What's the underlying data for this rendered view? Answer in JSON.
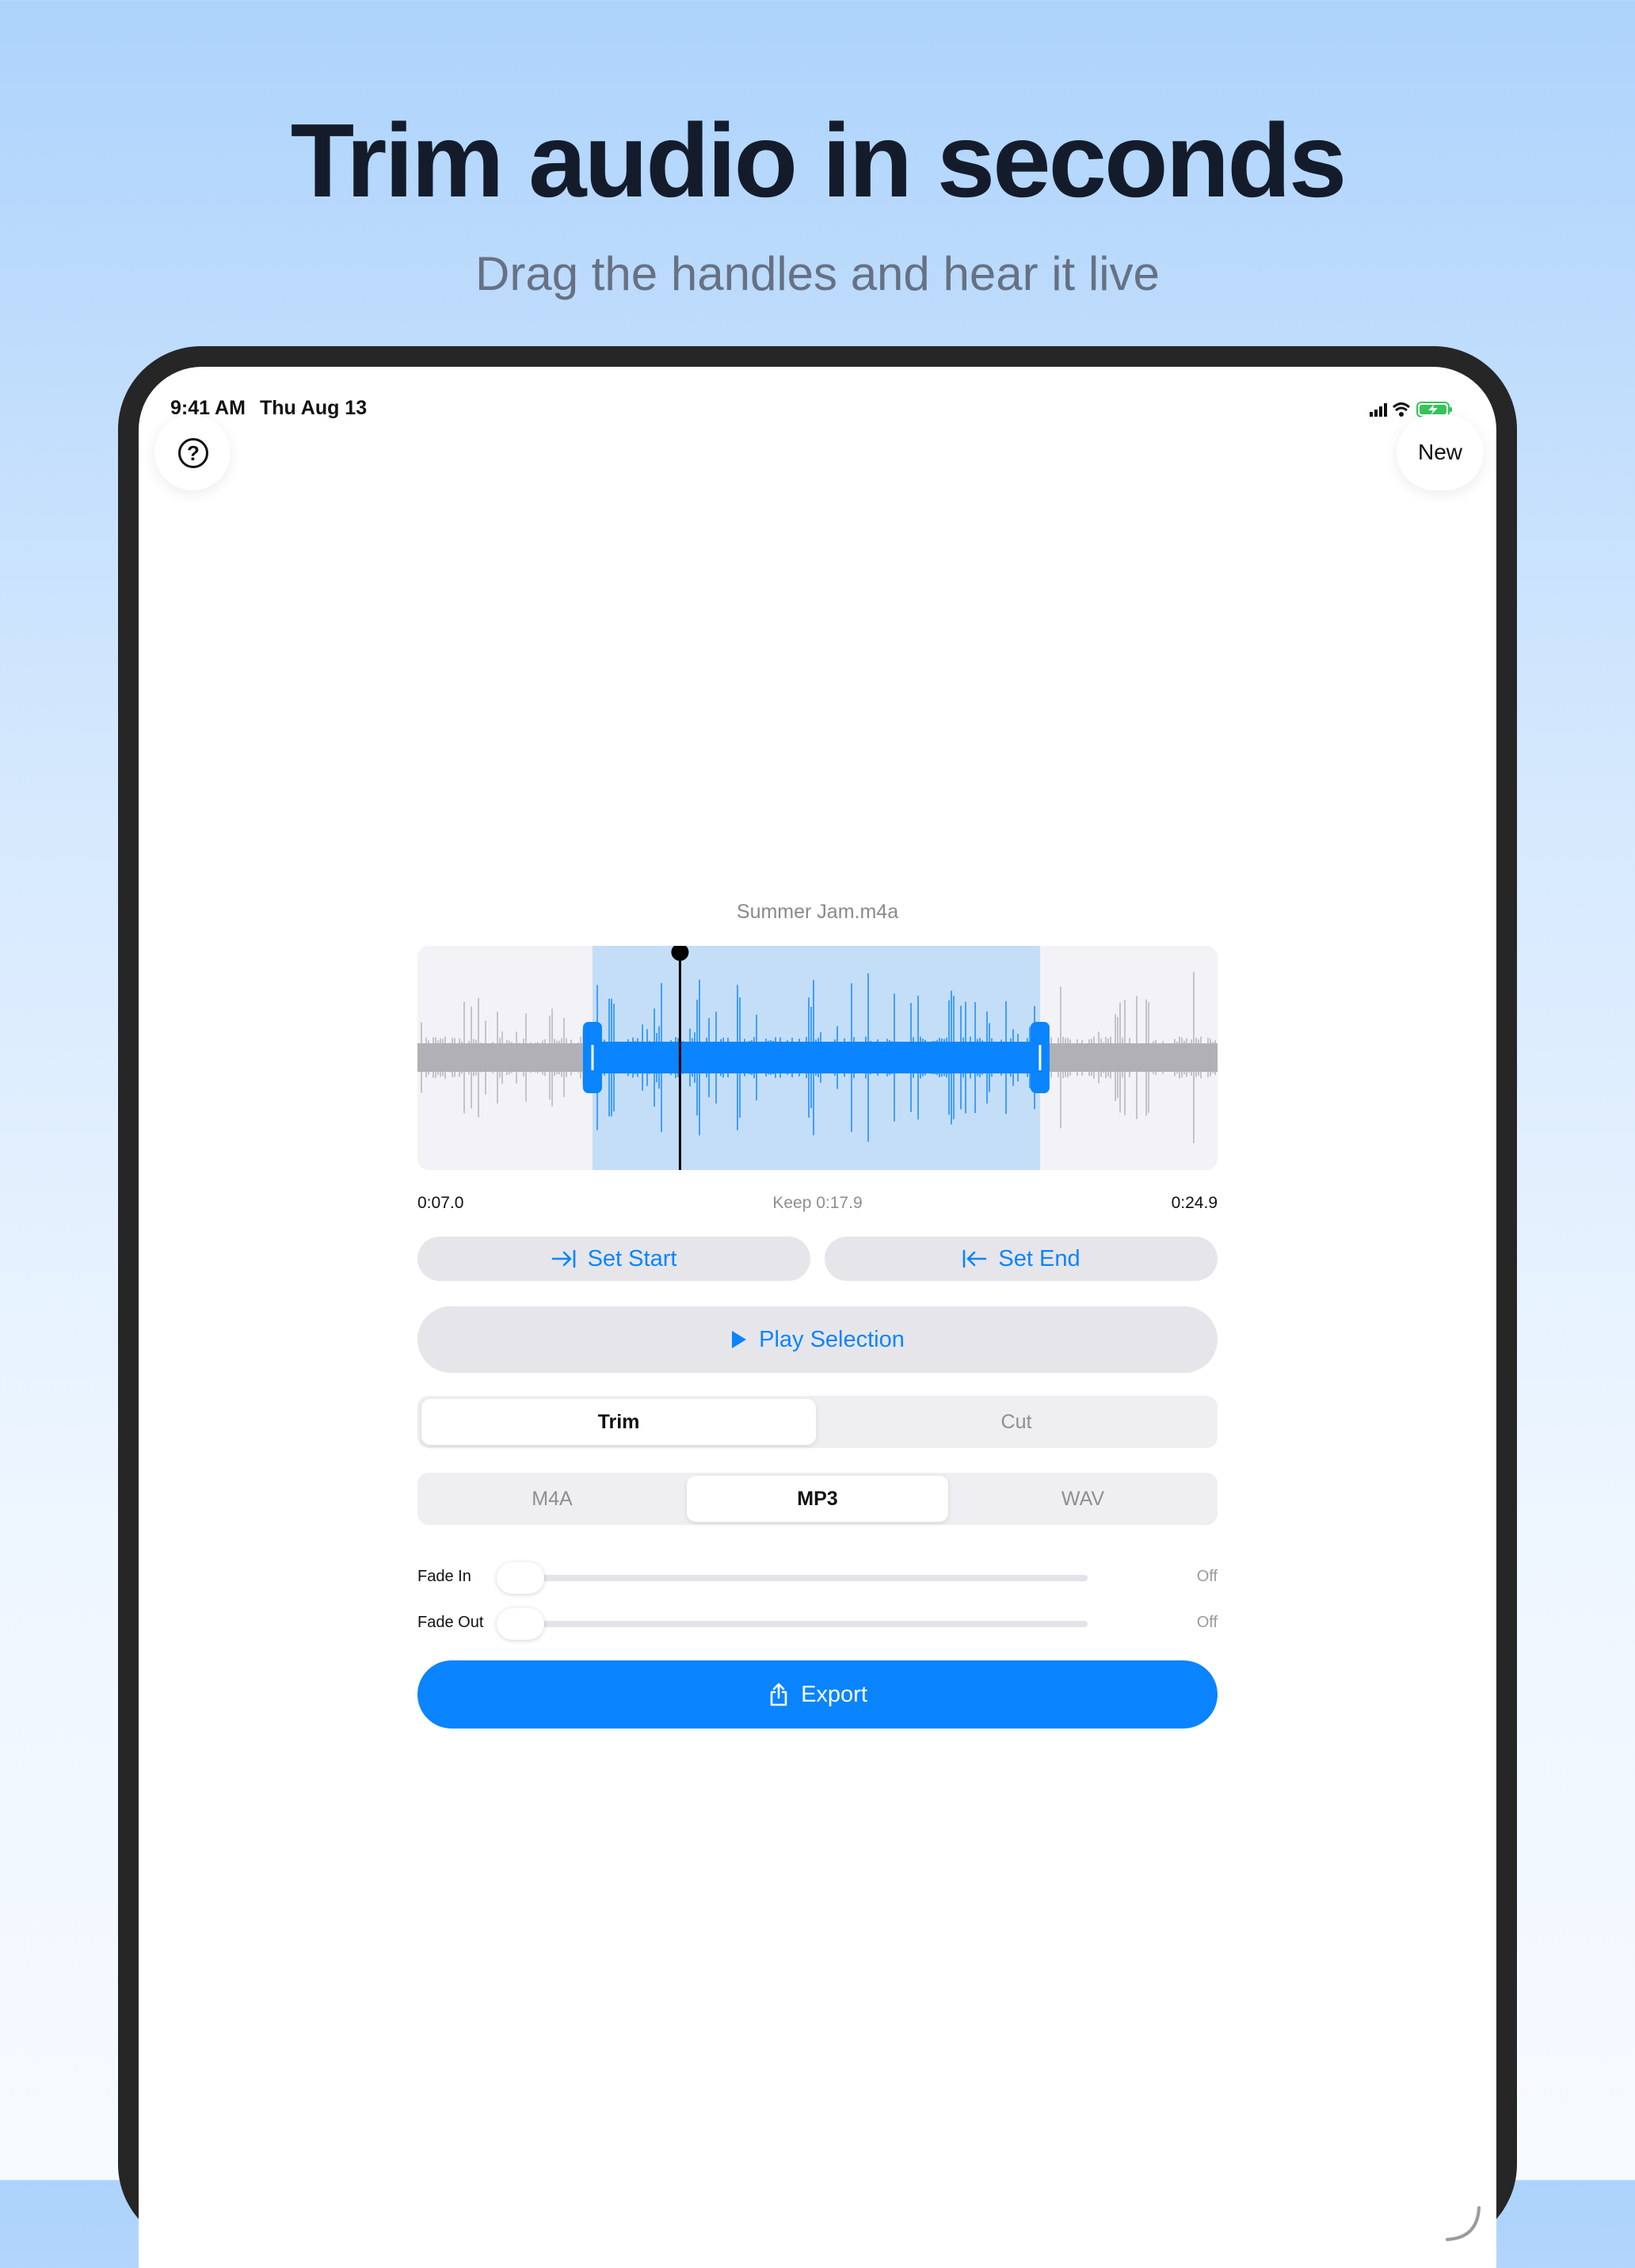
{
  "marketing": {
    "headline": "Trim audio in seconds",
    "subhead": "Drag the handles and hear it live"
  },
  "status_bar": {
    "time": "9:41 AM",
    "date": "Thu Aug 13"
  },
  "nav": {
    "new_label": "New"
  },
  "editor": {
    "file_name": "Summer Jam.m4a",
    "start_time": "0:07.0",
    "keep_label": "Keep 0:17.9",
    "end_time": "0:24.9",
    "selection": {
      "total_seconds": 32,
      "start_seconds": 7.0,
      "end_seconds": 24.9,
      "playhead_seconds": 10.5
    },
    "set_start_label": "Set Start",
    "set_end_label": "Set End",
    "play_selection_label": "Play Selection",
    "mode": {
      "options": [
        "Trim",
        "Cut"
      ],
      "selected": "Trim"
    },
    "format": {
      "options": [
        "M4A",
        "MP3",
        "WAV"
      ],
      "selected": "MP3"
    },
    "fade_in": {
      "label": "Fade In",
      "value": "Off"
    },
    "fade_out": {
      "label": "Fade Out",
      "value": "Off"
    },
    "export_label": "Export"
  },
  "colors": {
    "accent": "#0a84ff",
    "selection_fill": "#c4def8",
    "waveform_gray": "#b0b0b5",
    "waveform_blue": "#0a84ff"
  }
}
